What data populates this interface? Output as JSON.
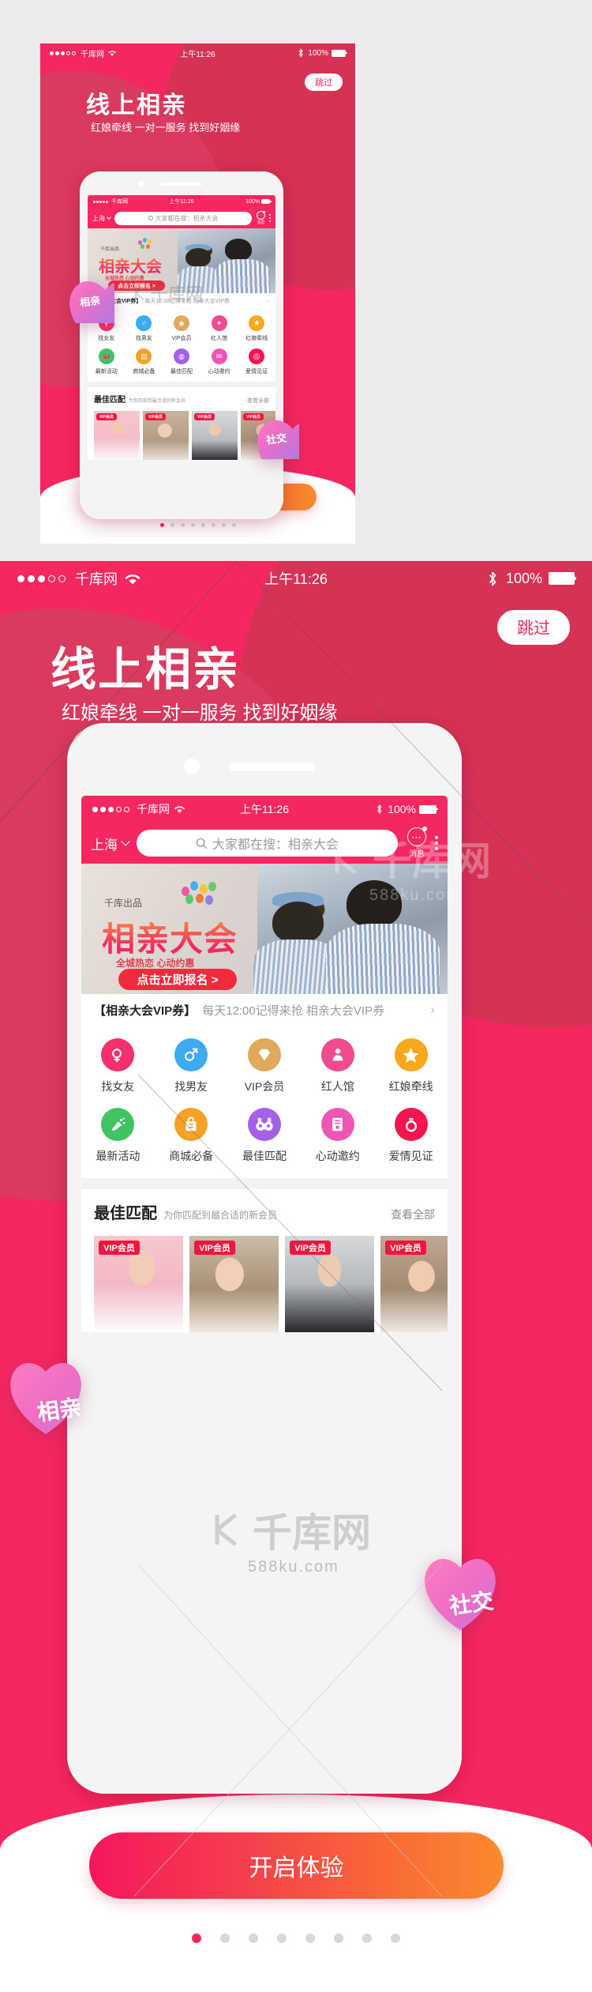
{
  "meta": {
    "accent": "#f5275f",
    "accent_dark": "#d63256",
    "cta_gradient_from": "#f5175c",
    "cta_gradient_to": "#f98a2e"
  },
  "status_bar": {
    "carrier": "千库网",
    "signal_dots_filled": 3,
    "signal_dots_total": 5,
    "wifi_icon": "wifi-icon",
    "time": "上午11:26",
    "bluetooth_icon": "bluetooth-icon",
    "battery_percent": "100%"
  },
  "skip": {
    "label": "跳过"
  },
  "hero": {
    "title": "线上相亲",
    "subtitle": "红娘牵线  一对一服务  找到好姻缘"
  },
  "app": {
    "status_bar": {
      "carrier": "千库网",
      "time": "上午11:26",
      "battery_percent": "100%"
    },
    "search": {
      "city": "上海",
      "city_chevron": "chevron-down-icon",
      "search_icon": "search-icon",
      "placeholder": "大家都在搜：相亲大会",
      "message_icon": "message-bubble-icon",
      "message_label": "消息",
      "more_icon": "kebab-menu-icon"
    },
    "banner": {
      "publisher": "千库出品",
      "title": "相亲大会",
      "subtitle": "全城热恋  心动约惠",
      "cta": "点击立即报名 >"
    },
    "coupon": {
      "title": "【相亲大会VIP券】",
      "desc": "每天12:00记得来抢 相亲大会VIP券",
      "arrow": "chevron-right-icon"
    },
    "grid": {
      "row1": [
        {
          "label": "找女友",
          "icon": "female-search-icon",
          "color": "#f4306d"
        },
        {
          "label": "找男友",
          "icon": "male-search-icon",
          "color": "#3eaaf0"
        },
        {
          "label": "VIP会员",
          "icon": "diamond-icon",
          "color": "#e0a95b"
        },
        {
          "label": "红人馆",
          "icon": "star-person-icon",
          "color": "#ef4b91"
        },
        {
          "label": "红娘牵线",
          "icon": "matchmaker-star-icon",
          "color": "#f8a81c"
        }
      ],
      "row2": [
        {
          "label": "最新活动",
          "icon": "megaphone-icon",
          "color": "#41c363"
        },
        {
          "label": "商城必备",
          "icon": "shopping-bag-icon",
          "color": "#f3a127"
        },
        {
          "label": "最佳匹配",
          "icon": "binoculars-icon",
          "color": "#a560e8"
        },
        {
          "label": "心动邀约",
          "icon": "love-letter-icon",
          "color": "#f055b5"
        },
        {
          "label": "爱情见证",
          "icon": "ring-icon",
          "color": "#f4174f"
        }
      ]
    },
    "best_match": {
      "title": "最佳匹配",
      "subtitle": "为你匹配到最合适的新会员",
      "view_all": "查看全部",
      "cards": [
        {
          "badge": "VIP会员",
          "bg": "#f7c6cf"
        },
        {
          "badge": "VIP会员",
          "bg": "#cdbcaa"
        },
        {
          "badge": "VIP会员",
          "bg": "#d3d7da"
        },
        {
          "badge": "VIP会员",
          "bg": "#b8a08c"
        }
      ]
    }
  },
  "cta": {
    "label": "开启体验"
  },
  "pagination": {
    "total": 8,
    "active_index": 0
  },
  "hearts": [
    {
      "label": "相亲"
    },
    {
      "label": "社交"
    }
  ],
  "watermark": {
    "brand": "千库网",
    "url": "588ku.com"
  }
}
